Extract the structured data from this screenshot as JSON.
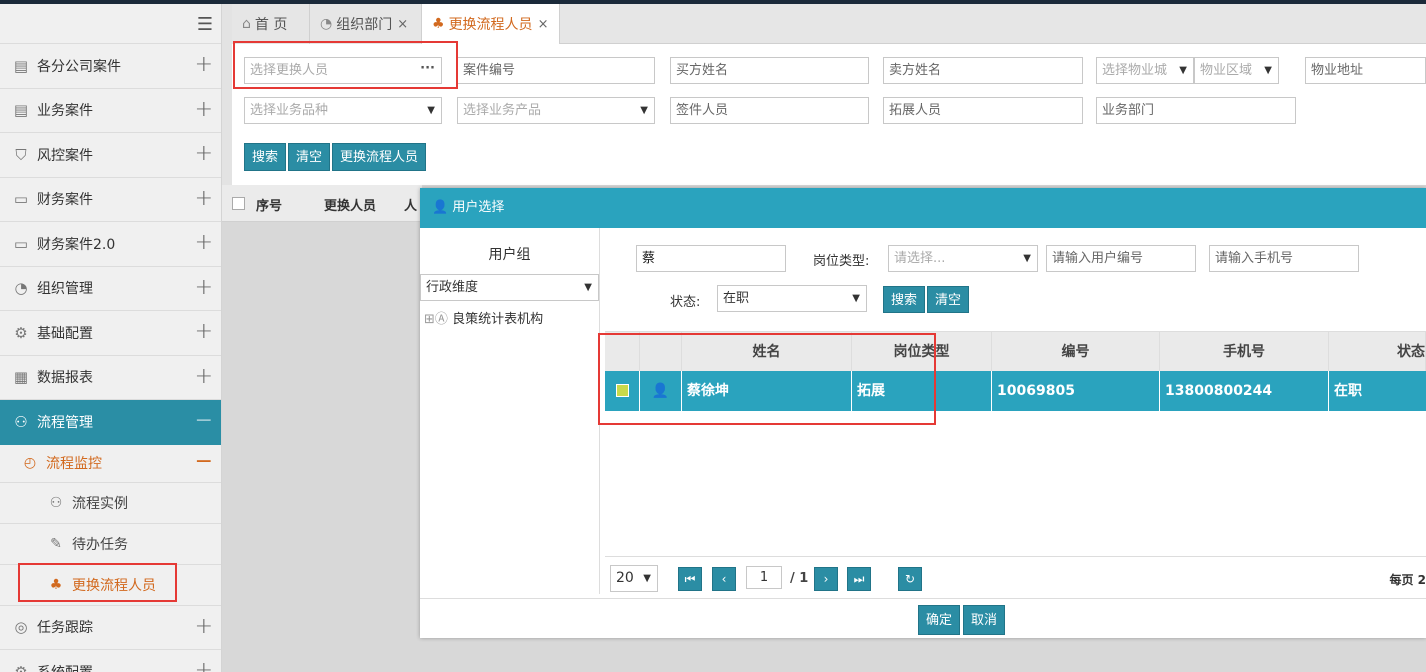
{
  "sidebar": {
    "items": [
      {
        "label": "各分公司案件",
        "icon": "clipboard-icon"
      },
      {
        "label": "业务案件",
        "icon": "clipboard-list-icon"
      },
      {
        "label": "风控案件",
        "icon": "shield-icon"
      },
      {
        "label": "财务案件",
        "icon": "wallet-icon"
      },
      {
        "label": "财务案件2.0",
        "icon": "ticket-icon"
      },
      {
        "label": "组织管理",
        "icon": "users-icon"
      },
      {
        "label": "基础配置",
        "icon": "sliders-icon"
      },
      {
        "label": "数据报表",
        "icon": "table-icon"
      },
      {
        "label": "流程管理",
        "icon": "flow-icon"
      }
    ],
    "sub_group": "流程监控",
    "sub_items": [
      "流程实例",
      "待办任务",
      "更换流程人员"
    ],
    "after_items": [
      "任务跟踪",
      "系统配置"
    ]
  },
  "tabs": [
    {
      "label": "首 页"
    },
    {
      "label": "组织部门"
    },
    {
      "label": "更换流程人员"
    }
  ],
  "search": {
    "row1": [
      "选择更换人员",
      "案件编号",
      "买方姓名",
      "卖方姓名",
      "选择物业城",
      "物业区域",
      "物业地址"
    ],
    "row2": [
      "选择业务品种",
      "选择业务产品",
      "签件人员",
      "拓展人员",
      "业务部门"
    ],
    "buttons": [
      "搜索",
      "清空",
      "更换流程人员"
    ]
  },
  "grid": {
    "headers": [
      "序号",
      "更换人员",
      "人"
    ]
  },
  "dialog": {
    "title": "用户选择",
    "left_title": "用户组",
    "dimension": "行政维度",
    "tree_root": "良策统计表机构",
    "name_value": "蔡",
    "position_label": "岗位类型:",
    "position_placeholder": "请选择...",
    "user_no_placeholder": "请输入用户编号",
    "phone_placeholder": "请输入手机号",
    "status_label": "状态:",
    "status_value": "在职",
    "search_btn": "搜索",
    "clear_btn": "清空",
    "columns": [
      "姓名",
      "岗位类型",
      "编号",
      "手机号",
      "状态"
    ],
    "rows": [
      {
        "name": "蔡徐坤",
        "position": "拓展",
        "no": "10069805",
        "phone": "13800800244",
        "status": "在职"
      }
    ],
    "page_size": "20",
    "page_current": "1",
    "page_total": "/ 1",
    "page_info": "每页 2",
    "ok_btn": "确定",
    "cancel_btn": "取消"
  },
  "colors": {
    "accent": "#2aa3be",
    "active_menu": "#2a8ea5",
    "highlight": "#e53935",
    "orange": "#d2691e"
  }
}
